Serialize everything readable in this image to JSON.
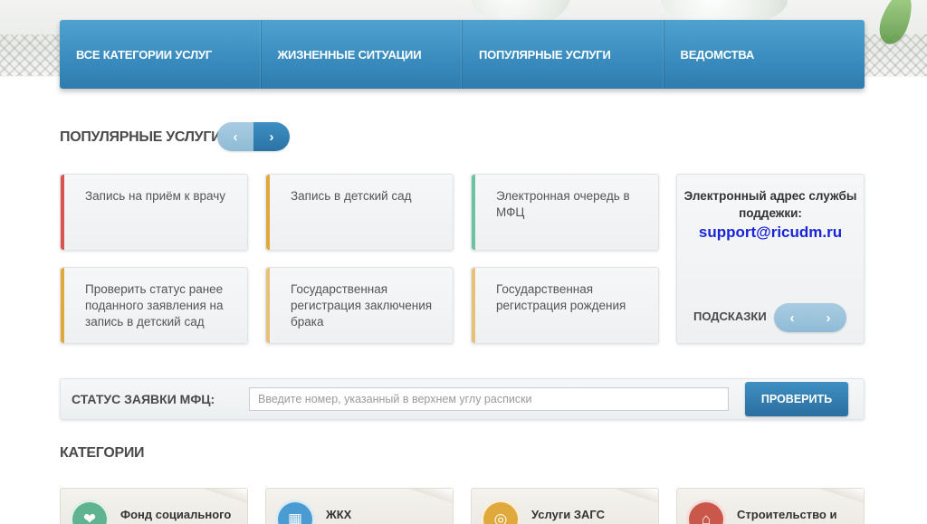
{
  "nav": {
    "items": [
      {
        "label": "ВСЕ КАТЕГОРИИ УСЛУГ"
      },
      {
        "label": "ЖИЗНЕННЫЕ СИТУАЦИИ"
      },
      {
        "label": "ПОПУЛЯРНЫЕ УСЛУГИ"
      },
      {
        "label": "ВЕДОМСТВА"
      }
    ]
  },
  "popular": {
    "title": "ПОПУЛЯРНЫЕ УСЛУГИ",
    "prev_icon": "‹",
    "next_icon": "›",
    "cards": [
      {
        "label": "Запись на приём к врачу",
        "accent": "#d9534f"
      },
      {
        "label": "Запись в детский сад",
        "accent": "#e0a93b"
      },
      {
        "label": "Электронная очередь в МФЦ",
        "accent": "#6cc3a0"
      },
      {
        "label": "Проверить статус ранее поданного заявления на запись в детский сад",
        "accent": "#e0a93b"
      },
      {
        "label": "Государственная регистрация заключения брака",
        "accent": "#e8c07a"
      },
      {
        "label": "Государственная регистрация рождения",
        "accent": "#e8c07a"
      }
    ]
  },
  "support": {
    "label": "Электронный адрес службы поддежки:",
    "email": "support@ricudm.ru",
    "hints_label": "ПОДСКАЗКИ",
    "prev_icon": "‹",
    "next_icon": "›"
  },
  "status": {
    "label": "СТАТУС ЗАЯВКИ МФЦ:",
    "placeholder": "Введите номер, указанный в верхнем углу расписки",
    "value": "",
    "button_label": "ПРОВЕРИТЬ"
  },
  "categories": {
    "title": "КАТЕГОРИИ",
    "items": [
      {
        "label": "Фонд социального",
        "icon": "❤",
        "color": "#5fb38f"
      },
      {
        "label": "ЖКХ",
        "icon": "▦",
        "color": "#4a9bd1"
      },
      {
        "label": "Услуги ЗАГС",
        "icon": "◎",
        "color": "#e0a93b"
      },
      {
        "label": "Строительство и",
        "icon": "⌂",
        "color": "#c9574a"
      }
    ]
  }
}
